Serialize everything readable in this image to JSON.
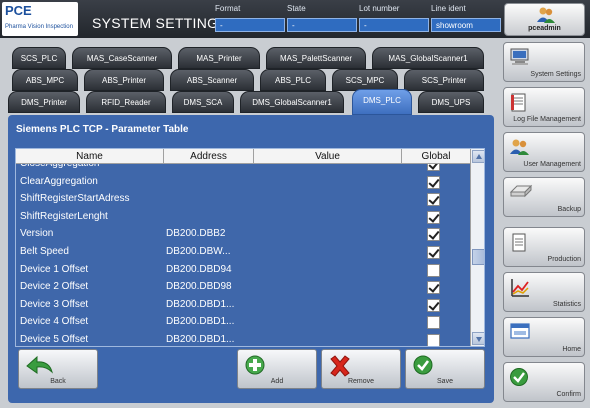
{
  "header": {
    "logo_title": "PCE",
    "logo_subtitle": "Pharma Vision Inspection",
    "title": "SYSTEM SETTINGS",
    "fields": [
      {
        "label": "Format",
        "value": "-"
      },
      {
        "label": "State",
        "value": "-"
      },
      {
        "label": "Lot number",
        "value": "-"
      },
      {
        "label": "Line ident",
        "value": "showroom"
      }
    ],
    "user": "pceadmin"
  },
  "tabs": {
    "row1": [
      "SCS_PLC",
      "MAS_CaseScanner",
      "MAS_Printer",
      "MAS_PalettScanner",
      "MAS_GlobalScanner1"
    ],
    "row2": [
      "ABS_MPC",
      "ABS_Printer",
      "ABS_Scanner",
      "ABS_PLC",
      "SCS_MPC",
      "SCS_Printer"
    ],
    "row3": [
      "DMS_Printer",
      "RFID_Reader",
      "DMS_SCA",
      "DMS_GlobalScanner1",
      "DMS_PLC",
      "DMS_UPS"
    ],
    "active": "DMS_PLC"
  },
  "panel": {
    "title": "Siemens PLC TCP - Parameter Table",
    "columns": [
      "Name",
      "Address",
      "Value",
      "Global"
    ],
    "rows": [
      {
        "name": "CloseAggregation",
        "address": "",
        "value": "",
        "global": true
      },
      {
        "name": "ClearAggregation",
        "address": "",
        "value": "",
        "global": true
      },
      {
        "name": "ShiftRegisterStartAdress",
        "address": "",
        "value": "",
        "global": true
      },
      {
        "name": "ShiftRegisterLenght",
        "address": "",
        "value": "",
        "global": true
      },
      {
        "name": "Version",
        "address": "DB200.DBB2",
        "value": "",
        "global": true
      },
      {
        "name": "Belt Speed",
        "address": "DB200.DBW...",
        "value": "",
        "global": true
      },
      {
        "name": "Device 1 Offset",
        "address": "DB200.DBD94",
        "value": "",
        "global": false
      },
      {
        "name": "Device 2 Offset",
        "address": "DB200.DBD98",
        "value": "",
        "global": true
      },
      {
        "name": "Device 3 Offset",
        "address": "DB200.DBD1...",
        "value": "",
        "global": true
      },
      {
        "name": "Device 4 Offset",
        "address": "DB200.DBD1...",
        "value": "",
        "global": false
      },
      {
        "name": "Device 5 Offset",
        "address": "DB200.DBD1...",
        "value": "",
        "global": false
      }
    ]
  },
  "buttons": {
    "back": "Back",
    "add": "Add",
    "remove": "Remove",
    "save": "Save"
  },
  "sidebar": {
    "items": [
      "System Settings",
      "Log File Management",
      "User Management",
      "Backup",
      "Production",
      "Statistics",
      "Home",
      "Confirm"
    ]
  },
  "colors": {
    "panel": "#3d67ad",
    "active_tab": "#5a8ad6",
    "header_field": "#2f6cc0"
  }
}
